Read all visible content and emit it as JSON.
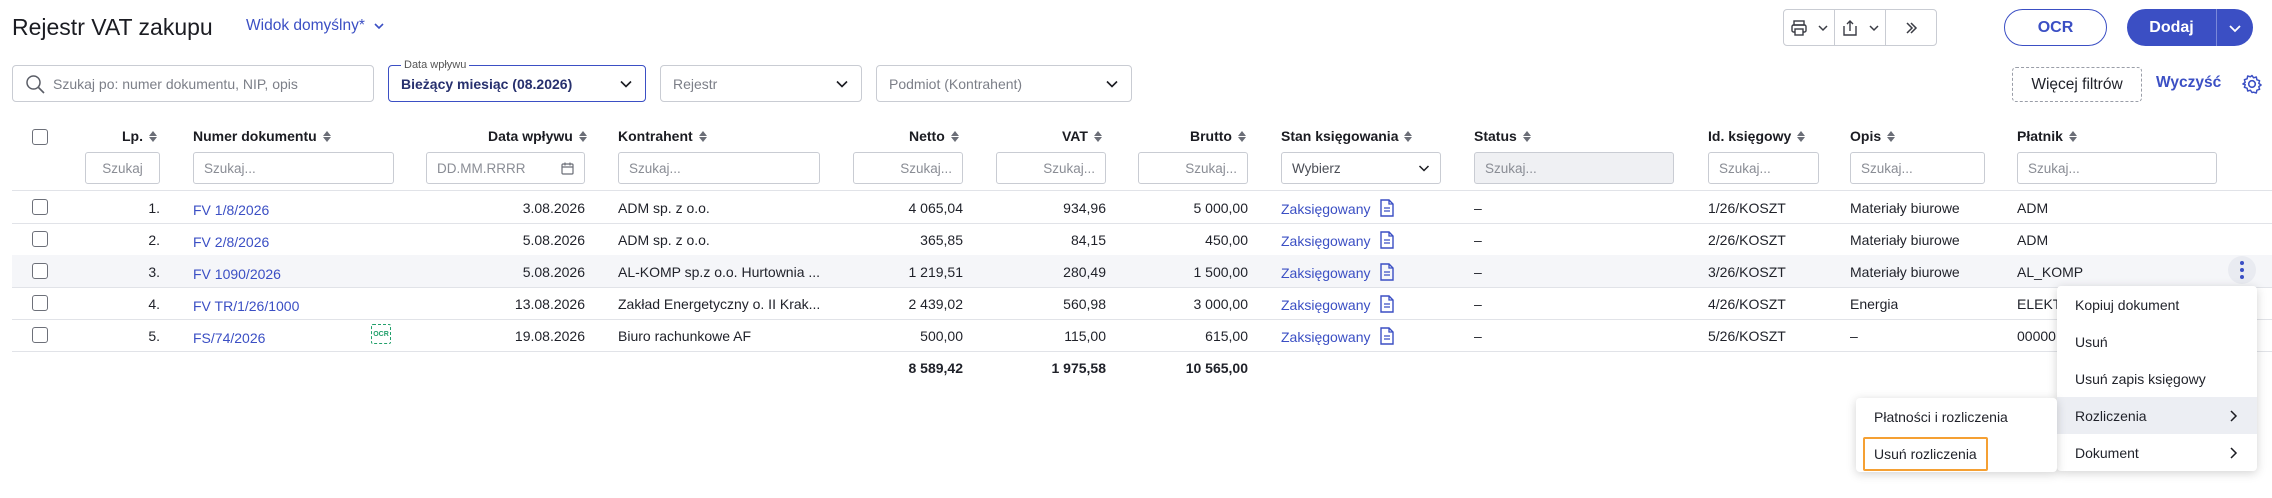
{
  "header": {
    "title": "Rejestr VAT zakupu",
    "view_label": "Widok domyślny*",
    "ocr_label": "OCR",
    "add_label": "Dodaj"
  },
  "filters": {
    "search_placeholder": "Szukaj po: numer dokumentu, NIP, opis",
    "date_label": "Data wpływu",
    "date_value": "Bieżący miesiąc (08.2026)",
    "register": "Rejestr",
    "subject": "Podmiot (Kontrahent)",
    "more_filters": "Więcej filtrów",
    "clear": "Wyczyść"
  },
  "columns": {
    "lp": "Lp.",
    "numer": "Numer dokumentu",
    "data": "Data wpływu",
    "kontrahent": "Kontrahent",
    "netto": "Netto",
    "vat": "VAT",
    "brutto": "Brutto",
    "stan": "Stan księgowania",
    "status": "Status",
    "id": "Id. księgowy",
    "opis": "Opis",
    "platnik": "Płatnik"
  },
  "column_filters": {
    "lp": "Szukaj",
    "numer": "Szukaj...",
    "data": "DD.MM.RRRR",
    "kontrahent": "Szukaj...",
    "netto": "Szukaj...",
    "vat": "Szukaj...",
    "brutto": "Szukaj...",
    "stan": "Wybierz",
    "status": "Szukaj...",
    "id": "Szukaj...",
    "opis": "Szukaj...",
    "platnik": "Szukaj..."
  },
  "rows": [
    {
      "lp": "1.",
      "numer": "FV 1/8/2026",
      "data": "3.08.2026",
      "kontrahent": "ADM sp. z o.o.",
      "netto": "4 065,04",
      "vat": "934,96",
      "brutto": "5 000,00",
      "stan": "Zaksięgowany",
      "status": "–",
      "id": "1/26/KOSZT",
      "opis": "Materiały biurowe",
      "platnik": "ADM"
    },
    {
      "lp": "2.",
      "numer": "FV 2/8/2026",
      "data": "5.08.2026",
      "kontrahent": "ADM sp. z o.o.",
      "netto": "365,85",
      "vat": "84,15",
      "brutto": "450,00",
      "stan": "Zaksięgowany",
      "status": "–",
      "id": "2/26/KOSZT",
      "opis": "Materiały biurowe",
      "platnik": "ADM"
    },
    {
      "lp": "3.",
      "numer": "FV 1090/2026",
      "data": "5.08.2026",
      "kontrahent": "AL-KOMP sp.z o.o. Hurtownia ...",
      "netto": "1 219,51",
      "vat": "280,49",
      "brutto": "1 500,00",
      "stan": "Zaksięgowany",
      "status": "–",
      "id": "3/26/KOSZT",
      "opis": "Materiały biurowe",
      "platnik": "AL_KOMP"
    },
    {
      "lp": "4.",
      "numer": "FV TR/1/26/1000",
      "data": "13.08.2026",
      "kontrahent": "Zakład Energetyczny o. II Krak...",
      "netto": "2 439,02",
      "vat": "560,98",
      "brutto": "3 000,00",
      "stan": "Zaksięgowany",
      "status": "–",
      "id": "4/26/KOSZT",
      "opis": "Energia",
      "platnik": "ELEKT"
    },
    {
      "lp": "5.",
      "numer": "FS/74/2026",
      "data": "19.08.2026",
      "kontrahent": "Biuro rachunkowe AF",
      "netto": "500,00",
      "vat": "115,00",
      "brutto": "615,00",
      "stan": "Zaksięgowany",
      "status": "–",
      "id": "5/26/KOSZT",
      "opis": "–",
      "platnik": "00000",
      "ocr_badge": "OCR"
    }
  ],
  "totals": {
    "netto": "8 589,42",
    "vat": "1 975,58",
    "brutto": "10 565,00"
  },
  "context_menu": {
    "items": [
      "Kopiuj dokument",
      "Usuń",
      "Usuń zapis księgowy",
      "Rozliczenia",
      "Dokument"
    ]
  },
  "submenu": {
    "items": [
      "Płatności i rozliczenia",
      "Usuń rozliczenia"
    ]
  },
  "colors": {
    "accent": "#3b4fc4",
    "highlight": "#f5a033",
    "ocr_badge": "#22a06b"
  }
}
